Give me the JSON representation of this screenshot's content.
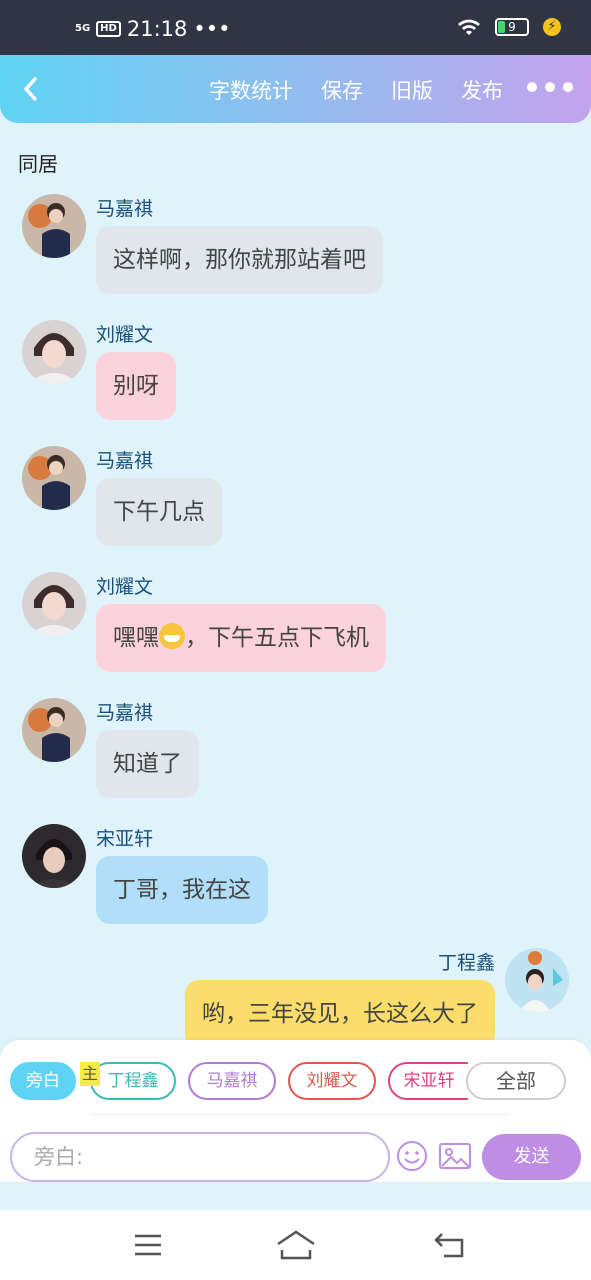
{
  "status_bar": {
    "network": "5G",
    "hd": "HD",
    "time": "21:18",
    "extra": "•••",
    "battery": "9"
  },
  "header": {
    "menu": [
      "字数统计",
      "保存",
      "旧版",
      "发布"
    ]
  },
  "chat": {
    "title": "同居",
    "messages": [
      {
        "name": "马嘉祺",
        "text": "这样啊，那你就那站着吧"
      },
      {
        "name": "刘耀文",
        "text": "别呀"
      },
      {
        "name": "马嘉祺",
        "text": "下午几点"
      },
      {
        "name": "刘耀文",
        "text_before": "嘿嘿",
        "text_after": "，下午五点下飞机",
        "emoji": "grinning-emoji"
      },
      {
        "name": "马嘉祺",
        "text": "知道了"
      },
      {
        "name": "宋亚轩",
        "text": "丁哥，我在这"
      },
      {
        "name": "丁程鑫",
        "text": "哟，三年没见，长这么大了"
      }
    ]
  },
  "composer": {
    "chips": {
      "narration": "旁白",
      "main_tag": "主",
      "ding": "丁程鑫",
      "ma": "马嘉祺",
      "liu": "刘耀文",
      "song": "宋亚轩",
      "all": "全部"
    },
    "placeholder": "旁白:",
    "send": "发送"
  },
  "colors": {
    "header_start": "#5fd3f3",
    "header_end": "#c4a2ee",
    "bubble_ma": "#e1e6ec",
    "bubble_liu": "#fcd2dd",
    "bubble_song": "#b1def8",
    "bubble_ding": "#fbdd6c"
  }
}
